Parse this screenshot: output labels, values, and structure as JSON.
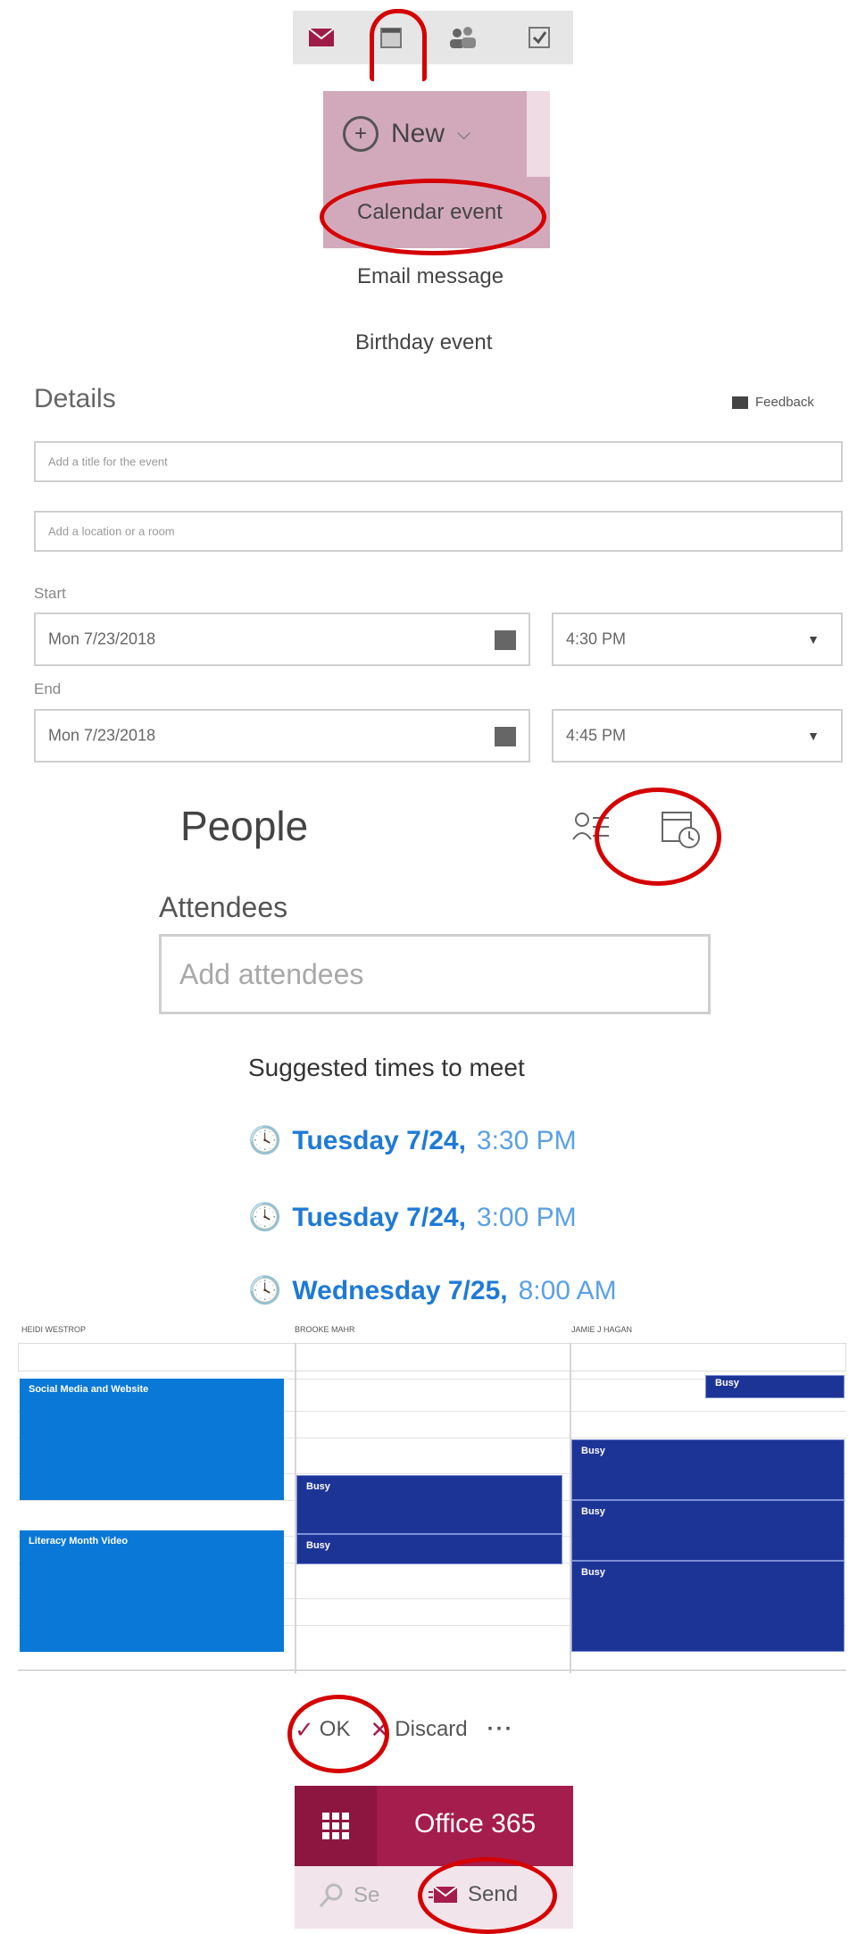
{
  "toolbar_icons": [
    "mail-icon",
    "calendar-icon",
    "people-icon",
    "tasks-icon"
  ],
  "new_menu": {
    "button_label": "New",
    "items": [
      "Calendar event",
      "Email message",
      "Birthday event"
    ]
  },
  "details": {
    "title": "Details",
    "feedback_label": "Feedback",
    "title_placeholder": "Add a title for the event",
    "location_placeholder": "Add a location or a room",
    "start_label": "Start",
    "start_date": "Mon 7/23/2018",
    "start_time": "4:30 PM",
    "end_label": "End",
    "end_date": "Mon 7/23/2018",
    "end_time": "4:45 PM"
  },
  "people": {
    "title": "People",
    "attendees_label": "Attendees",
    "attendees_placeholder": "Add attendees",
    "suggested_title": "Suggested times to meet",
    "suggestions": [
      {
        "day": "Tuesday 7/24,",
        "time": "3:30 PM"
      },
      {
        "day": "Tuesday 7/24,",
        "time": "3:00 PM"
      },
      {
        "day": "Wednesday 7/25,",
        "time": "8:00 AM"
      }
    ]
  },
  "schedule": {
    "columns": [
      "HEIDI WESTROP",
      "BROOKE MAHR",
      "JAMIE J HAGAN"
    ],
    "events": {
      "social_media": "Social Media and Website",
      "literacy": "Literacy Month Video",
      "busy": "Busy"
    }
  },
  "actions": {
    "ok": "OK",
    "discard": "Discard",
    "more": "···"
  },
  "office": {
    "brand": "Office 365",
    "search_label": "Se",
    "send_label": "Send"
  },
  "colors": {
    "brand": "#a51d4c",
    "link": "#1f7ad6",
    "busy_dark": "#1d3497",
    "event_light": "#0a78d6",
    "annotation": "#d50000"
  }
}
